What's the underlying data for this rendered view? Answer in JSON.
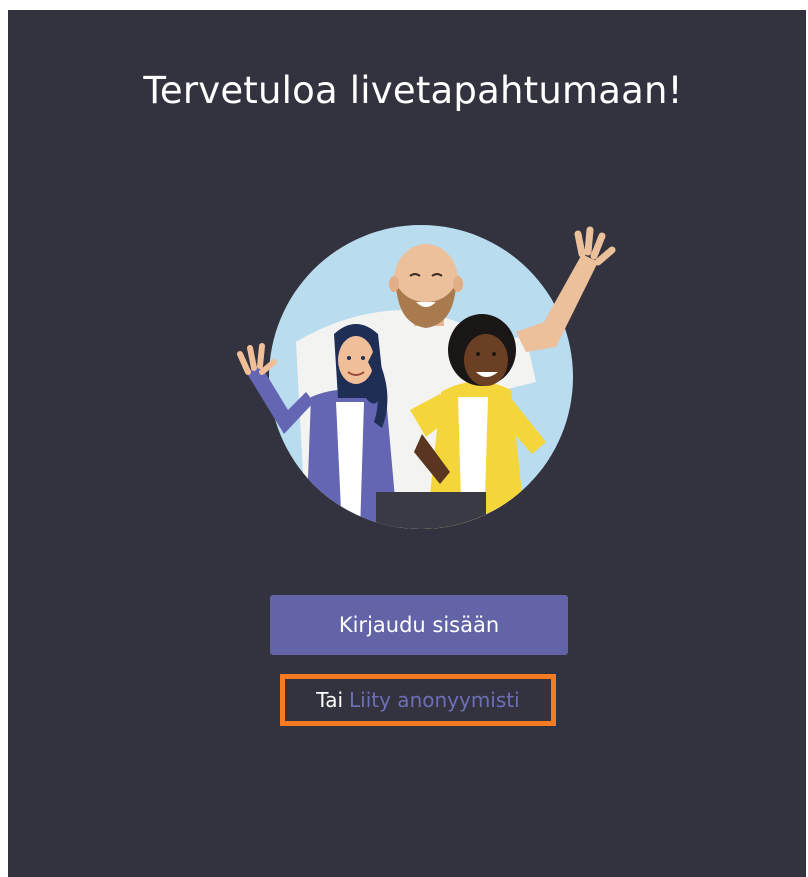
{
  "page": {
    "title": "Tervetuloa livetapahtumaan!"
  },
  "actions": {
    "signin_label": "Kirjaudu sisään",
    "or_label": "Tai",
    "anonymous_label": "Liity anonyymisti"
  },
  "illustration": {
    "icon": "people-waving-illustration"
  },
  "colors": {
    "background": "#33323f",
    "accent": "#6264a7",
    "link": "#6c6fb6",
    "highlight": "#f57c20"
  }
}
